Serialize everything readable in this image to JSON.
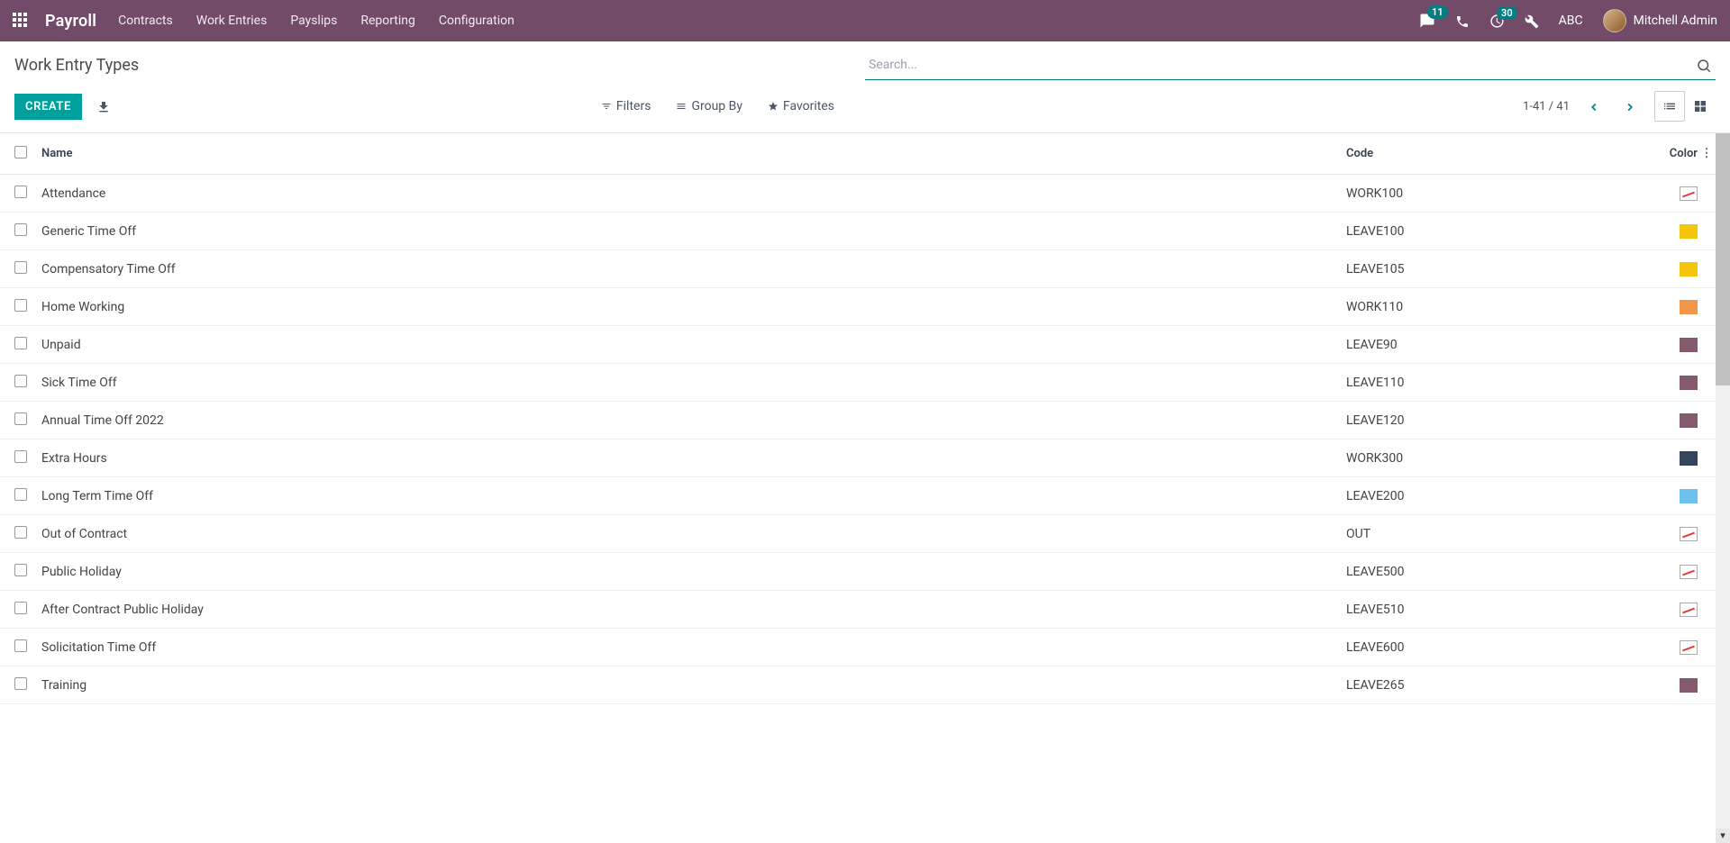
{
  "header": {
    "app_name": "Payroll",
    "menu": [
      "Contracts",
      "Work Entries",
      "Payslips",
      "Reporting",
      "Configuration"
    ],
    "messages_badge": "11",
    "events_badge": "30",
    "company": "ABC",
    "user": "Mitchell Admin"
  },
  "cp": {
    "breadcrumb": "Work Entry Types",
    "search_placeholder": "Search...",
    "create_label": "CREATE",
    "filters_label": "Filters",
    "groupby_label": "Group By",
    "favorites_label": "Favorites",
    "pager": "1-41 / 41"
  },
  "table": {
    "headers": {
      "name": "Name",
      "code": "Code",
      "color": "Color"
    },
    "rows": [
      {
        "name": "Attendance",
        "code": "WORK100",
        "color": "none"
      },
      {
        "name": "Generic Time Off",
        "code": "LEAVE100",
        "color": "yellow"
      },
      {
        "name": "Compensatory Time Off",
        "code": "LEAVE105",
        "color": "yellow"
      },
      {
        "name": "Home Working",
        "code": "WORK110",
        "color": "orange"
      },
      {
        "name": "Unpaid",
        "code": "LEAVE90",
        "color": "purple"
      },
      {
        "name": "Sick Time Off",
        "code": "LEAVE110",
        "color": "purple"
      },
      {
        "name": "Annual Time Off 2022",
        "code": "LEAVE120",
        "color": "purple"
      },
      {
        "name": "Extra Hours",
        "code": "WORK300",
        "color": "navy"
      },
      {
        "name": "Long Term Time Off",
        "code": "LEAVE200",
        "color": "lightblue"
      },
      {
        "name": "Out of Contract",
        "code": "OUT",
        "color": "none"
      },
      {
        "name": "Public Holiday",
        "code": "LEAVE500",
        "color": "none"
      },
      {
        "name": "After Contract Public Holiday",
        "code": "LEAVE510",
        "color": "none"
      },
      {
        "name": "Solicitation Time Off",
        "code": "LEAVE600",
        "color": "none"
      },
      {
        "name": "Training",
        "code": "LEAVE265",
        "color": "purple"
      }
    ]
  }
}
